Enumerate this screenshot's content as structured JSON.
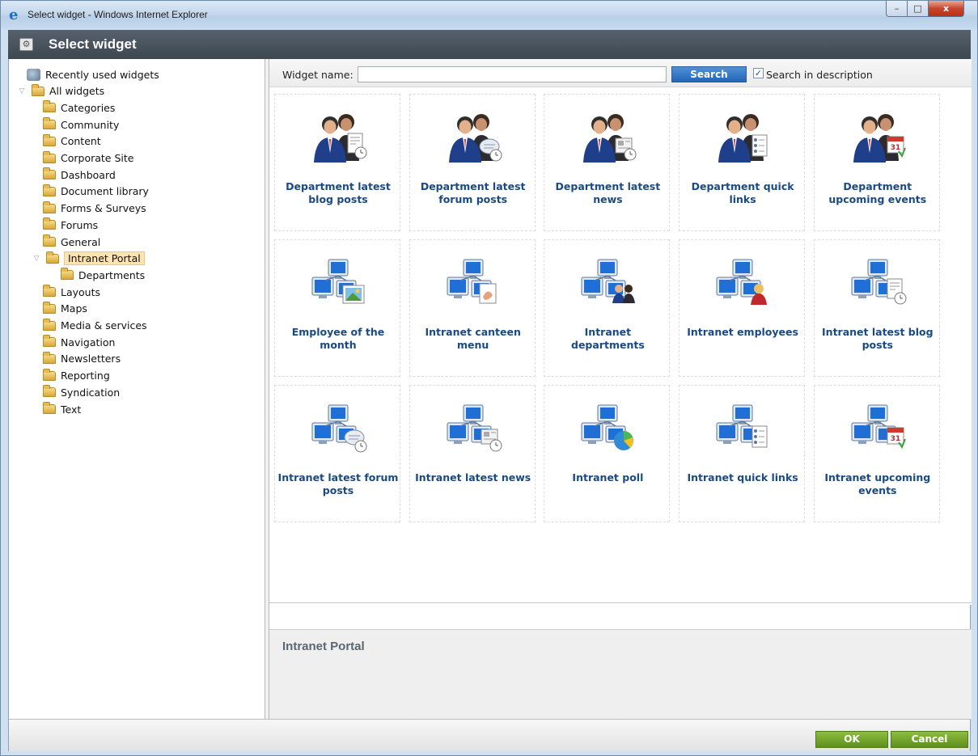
{
  "window": {
    "title": "Select widget - Windows Internet Explorer",
    "controls": {
      "minimize": "–",
      "maximize": "□",
      "close": "x"
    }
  },
  "dialog": {
    "title": "Select widget"
  },
  "tree": {
    "recent": "Recently used widgets",
    "root": "All widgets",
    "items": [
      "Categories",
      "Community",
      "Content",
      "Corporate Site",
      "Dashboard",
      "Document library",
      "Forms & Surveys",
      "Forums",
      "General",
      "Intranet Portal",
      "Departments",
      "Layouts",
      "Maps",
      "Media & services",
      "Navigation",
      "Newsletters",
      "Reporting",
      "Syndication",
      "Text"
    ],
    "selected": "Intranet Portal"
  },
  "search": {
    "label": "Widget name:",
    "value": "",
    "button": "Search",
    "checkbox_checked": true,
    "checkbox_label": "Search in description"
  },
  "widgets": [
    {
      "label": "Department latest blog posts",
      "icon": "people-blog-icon"
    },
    {
      "label": "Department latest forum posts",
      "icon": "people-forum-icon"
    },
    {
      "label": "Department latest news",
      "icon": "people-news-icon"
    },
    {
      "label": "Department quick links",
      "icon": "people-links-icon"
    },
    {
      "label": "Department upcoming events",
      "icon": "people-calendar-icon"
    },
    {
      "label": "Employee of the month",
      "icon": "network-picture-icon"
    },
    {
      "label": "Intranet canteen menu",
      "icon": "network-menu-icon"
    },
    {
      "label": "Intranet departments",
      "icon": "network-people-icon"
    },
    {
      "label": "Intranet employees",
      "icon": "network-person-icon"
    },
    {
      "label": "Intranet latest blog posts",
      "icon": "network-blog-icon"
    },
    {
      "label": "Intranet latest forum posts",
      "icon": "network-forum-icon"
    },
    {
      "label": "Intranet latest news",
      "icon": "network-news-icon"
    },
    {
      "label": "Intranet poll",
      "icon": "network-poll-icon"
    },
    {
      "label": "Intranet quick links",
      "icon": "network-links-icon"
    },
    {
      "label": "Intranet upcoming events",
      "icon": "network-calendar-icon"
    }
  ],
  "description": {
    "title": "Intranet Portal"
  },
  "footer": {
    "ok": "OK",
    "cancel": "Cancel"
  },
  "colors": {
    "accent": "#1a4a86",
    "header": "#465059",
    "ok_green": "#6f9f28",
    "selection": "#ffe4b2"
  }
}
